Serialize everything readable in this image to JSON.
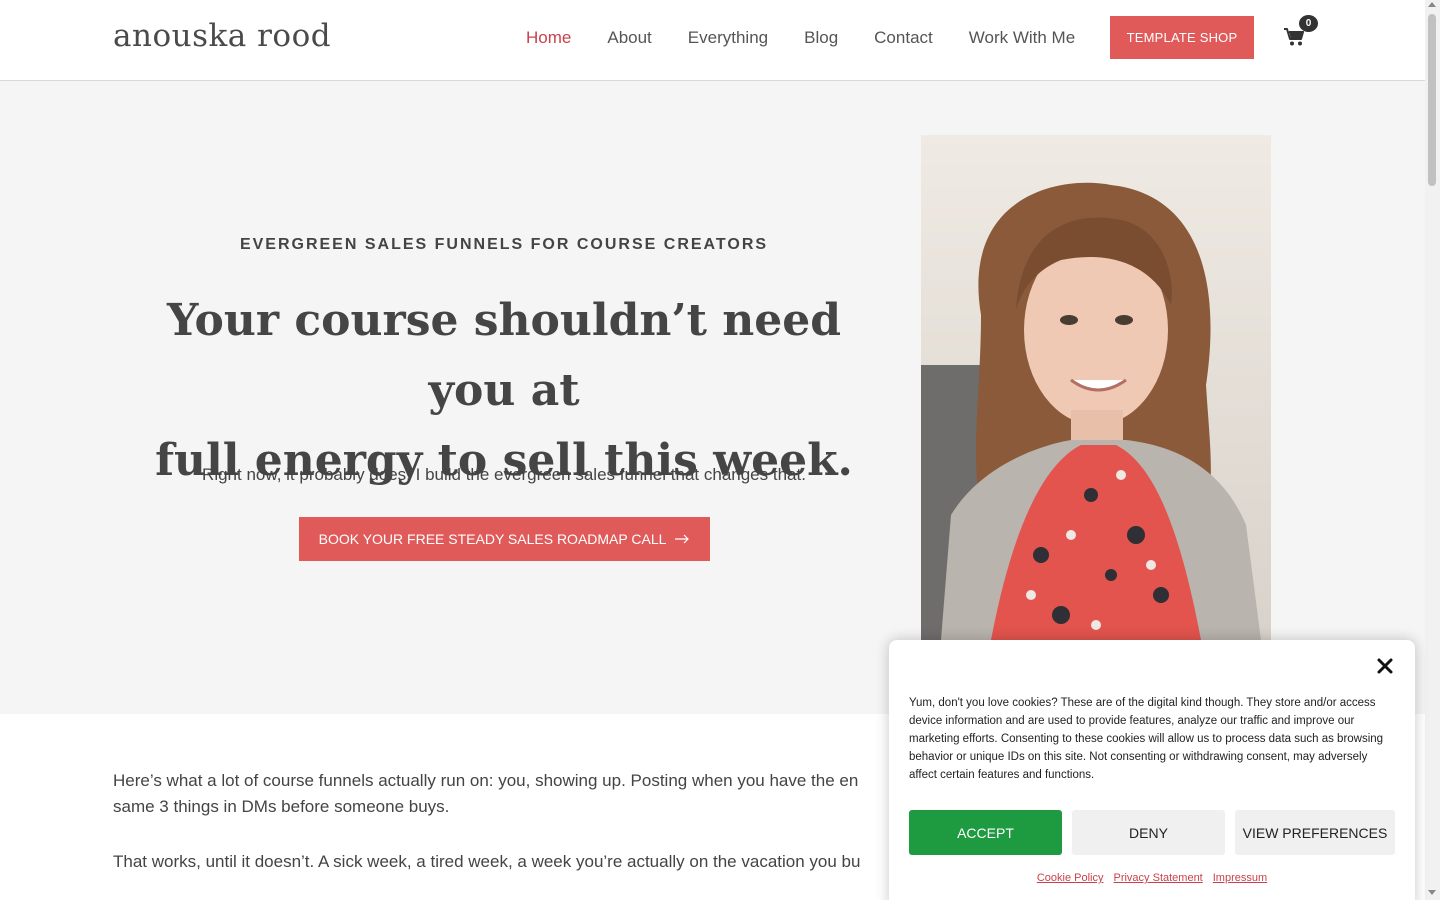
{
  "header": {
    "logo": "anouska rood",
    "nav": [
      {
        "label": "Home",
        "active": true
      },
      {
        "label": "About"
      },
      {
        "label": "Everything"
      },
      {
        "label": "Blog"
      },
      {
        "label": "Contact"
      },
      {
        "label": "Work With Me"
      }
    ],
    "shop_button": "TEMPLATE SHOP",
    "cart_count": "0",
    "cart_icon": "shopping-cart-icon"
  },
  "hero": {
    "eyebrow": "EVERGREEN SALES FUNNELS FOR COURSE CREATORS",
    "headline_line1": "Your course shouldn’t need you at",
    "headline_line2": "full energy to sell this week.",
    "subtext": "Right now, it probably does. I build the evergreen sales funnel that changes that.",
    "cta": "BOOK YOUR FREE STEADY SALES ROADMAP CALL",
    "cta_icon": "arrow-right-icon"
  },
  "content": {
    "p1_line1": "Here’s what a lot of course funnels actually run on: you, showing up. Posting when you have the en",
    "p1_line2": "same 3 things in DMs before someone buys.",
    "p2": "That works, until it doesn’t. A sick week, a tired week, a week you’re actually on the vacation you bu"
  },
  "cookie": {
    "text": "Yum, don't you love cookies? These are of the digital kind though. They store and/or access device information and are used to provide features, analyze our traffic and improve our marketing efforts. Consenting to these cookies will allow us to process data such as browsing behavior or unique IDs on this site. Not consenting or withdrawing consent, may adversely affect certain features and functions.",
    "accept": "ACCEPT",
    "deny": "DENY",
    "preferences": "VIEW PREFERENCES",
    "links": [
      "Cookie Policy",
      "Privacy Statement",
      "Impressum"
    ]
  },
  "colors": {
    "accent": "#e05a5a",
    "nav_active": "#c9424a",
    "accept_green": "#1e9a40",
    "hero_bg": "#f5f5f5"
  }
}
